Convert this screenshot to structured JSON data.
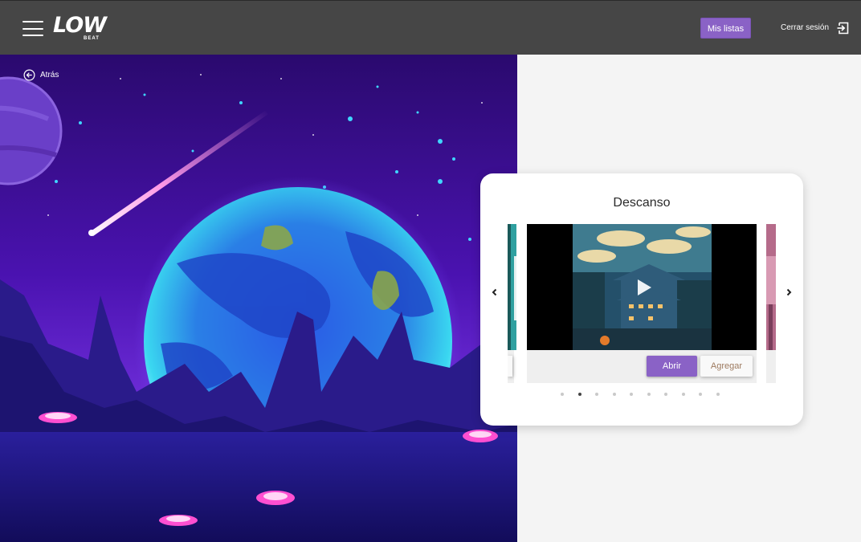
{
  "header": {
    "logo_main": "LOW",
    "logo_sub": "BEAT",
    "my_lists_label": "Mis listas",
    "logout_label": "Cerrar sesión",
    "icons": {
      "menu": "hamburger-icon",
      "logout": "logout-icon"
    }
  },
  "back": {
    "label": "Atrás",
    "icon": "back-arrow-icon"
  },
  "carousel": {
    "title": "Descanso",
    "open_label": "Abrir",
    "add_label": "Agregar",
    "active_index": 1,
    "dot_count": 10,
    "icons": {
      "prev": "chevron-left-icon",
      "next": "chevron-right-icon",
      "play": "play-icon"
    }
  },
  "colors": {
    "header_bg": "#464646",
    "accent": "#8a62c6",
    "page_bg": "#f4f4f4"
  }
}
